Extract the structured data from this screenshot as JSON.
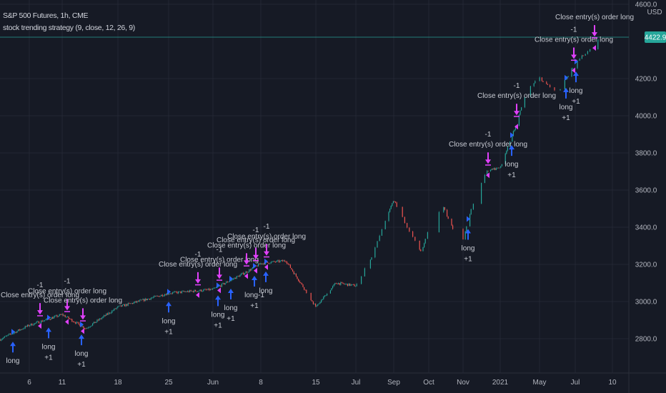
{
  "legend": {
    "symbol": "S&P 500 Futures, 1h, CME",
    "strategy": "stock trending strategy (9, close, 12, 26, 9)"
  },
  "colors": {
    "background": "#161a25",
    "grid": "#232734",
    "up_candle": "#26a69a",
    "down_candle": "#ef5350",
    "entry_arrow": "#2962ff",
    "exit_arrow": "#e040fb",
    "last_price": "#26a69a"
  },
  "chart_data": {
    "type": "candlestick",
    "title": "S&P 500 Futures, 1h, CME",
    "y_axis": {
      "currency": "USD",
      "ticks": [
        2800,
        3000,
        3200,
        3400,
        3600,
        3800,
        4000,
        4200,
        4600
      ],
      "range": [
        2600,
        4610
      ],
      "side": "right"
    },
    "x_axis": {
      "ticks": [
        "6",
        "11",
        "18",
        "25",
        "Jun",
        "8",
        "15",
        "Jul",
        "Sep",
        "Oct",
        "Nov",
        "2021",
        "May",
        "Jul",
        "10"
      ]
    },
    "last_price": "4422.9",
    "grid": true,
    "close_path": [
      2815,
      2873,
      2930,
      2855,
      2970,
      3045,
      3065,
      3160,
      3205,
      3220,
      3045,
      2970,
      3100,
      3085,
      3240,
      3550,
      3400,
      3260,
      3400,
      3510,
      3290,
      3510,
      3700,
      3720,
      3930,
      4160,
      4200,
      4120,
      4280,
      4420
    ],
    "signals": [
      {
        "type": "entry",
        "label": "long",
        "qty": ""
      },
      {
        "type": "entry",
        "label": "long",
        "qty": "+1"
      },
      {
        "type": "entry",
        "label": "long",
        "qty": "+1"
      },
      {
        "type": "entry",
        "label": "long",
        "qty": "+1"
      },
      {
        "type": "entry",
        "label": "long",
        "qty": "+1"
      },
      {
        "type": "entry",
        "label": "long",
        "qty": "+1"
      },
      {
        "type": "entry",
        "label": "long-1",
        "qty": "+1"
      },
      {
        "type": "entry",
        "label": "long",
        "qty": ""
      },
      {
        "type": "entry",
        "label": "long",
        "qty": "+1"
      },
      {
        "type": "entry",
        "label": "long",
        "qty": "+1"
      },
      {
        "type": "entry",
        "label": "long",
        "qty": "+1"
      },
      {
        "type": "entry",
        "label": "long",
        "qty": "+1"
      },
      {
        "type": "exit",
        "label": "Close entry(s) order long",
        "qty": "-1"
      },
      {
        "type": "exit",
        "label": "Close entry(s) order long",
        "qty": "-1"
      },
      {
        "type": "exit",
        "label": "Close entry(s) order long",
        "qty": ""
      },
      {
        "type": "exit",
        "label": "Close entry(s) order long",
        "qty": "-1"
      },
      {
        "type": "exit",
        "label": "Close entry(s) order long",
        "qty": "-1"
      },
      {
        "type": "exit",
        "label": "Close entry(s) order long",
        "qty": ""
      },
      {
        "type": "exit",
        "label": "Close entry(s) order long",
        "qty": "-1"
      },
      {
        "type": "exit",
        "label": "Close entry(s) order long",
        "qty": "-1"
      },
      {
        "type": "exit",
        "label": "Close entry(s) order long",
        "qty": "-1"
      },
      {
        "type": "exit",
        "label": "Close entry(s) order long",
        "qty": "-1"
      },
      {
        "type": "exit",
        "label": "Close entry(s) order long",
        "qty": "-1"
      },
      {
        "type": "exit",
        "label": "Close entry(s) order long",
        "qty": ""
      }
    ]
  }
}
